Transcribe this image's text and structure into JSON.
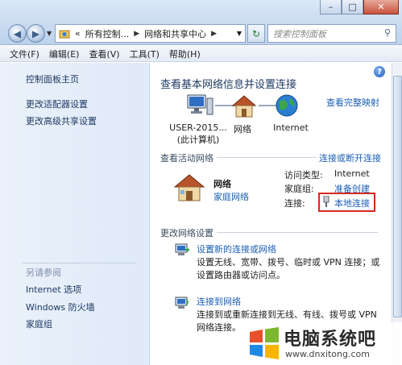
{
  "address": {
    "crumbs": [
      "«",
      "所有控制...",
      "网络和共享中心"
    ]
  },
  "search": {
    "placeholder": "搜索控制面板"
  },
  "menu": [
    "文件(F)",
    "编辑(E)",
    "查看(V)",
    "工具(T)",
    "帮助(H)"
  ],
  "left_pane": {
    "links": [
      "控制面板主页",
      "更改适配器设置",
      "更改高级共享设置"
    ],
    "see_also_label": "另请参阅",
    "see_also": [
      "Internet 选项",
      "Windows 防火墙",
      "家庭组"
    ]
  },
  "main": {
    "title": "查看基本网络信息并设置连接",
    "full_map": "查看完整映射",
    "nodes": [
      {
        "label": "USER-2015...",
        "sub": "(此计算机)"
      },
      {
        "label": "网络",
        "sub": ""
      },
      {
        "label": "Internet",
        "sub": ""
      }
    ],
    "active_title": "查看活动网络",
    "connect_disconnect": "连接或断开连接",
    "network": {
      "name": "网络",
      "type": "家庭网络"
    },
    "details": {
      "access_type_label": "访问类型:",
      "access_type_value": "Internet",
      "homegroup_label": "家庭组:",
      "homegroup_value": "准备创建",
      "connection_label": "连接:",
      "connection_value": "本地连接"
    },
    "change_title": "更改网络设置",
    "tasks": [
      {
        "title": "设置新的连接或网络",
        "desc": "设置无线、宽带、拨号、临时或 VPN 连接；或设置路由器或访问点。"
      },
      {
        "title": "连接到网络",
        "desc": "连接到或重新连接到无线、有线、拨号或 VPN 网络连接。"
      }
    ]
  },
  "watermark": {
    "name": "电脑系统吧",
    "url": "www.dnxitong.com"
  },
  "colors": {
    "link": "#1a5fb4",
    "highlight_box": "#d8271c"
  }
}
